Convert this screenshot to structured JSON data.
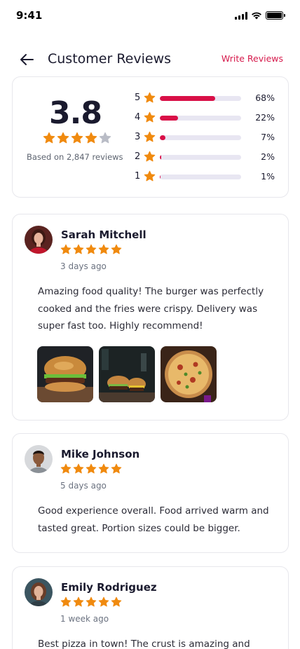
{
  "status": {
    "time": "9:41"
  },
  "header": {
    "title": "Customer Reviews",
    "write_label": "Write Reviews"
  },
  "summary": {
    "average": "3.8",
    "average_stars_filled": 4,
    "based_on": "Based on 2,847 reviews",
    "distribution": [
      {
        "stars": "5",
        "percent": "68%",
        "value": 68
      },
      {
        "stars": "4",
        "percent": "22%",
        "value": 22
      },
      {
        "stars": "3",
        "percent": "7%",
        "value": 7
      },
      {
        "stars": "2",
        "percent": "2%",
        "value": 2
      },
      {
        "stars": "1",
        "percent": "1%",
        "value": 1
      }
    ]
  },
  "reviews": [
    {
      "name": "Sarah Mitchell",
      "rating": 5,
      "date": "3 days ago",
      "text": "Amazing food quality! The burger was perfectly cooked and the fries were crispy. Delivery was super fast too. Highly recommend!",
      "photos": [
        "burger-photo",
        "burgers-photo",
        "pizza-photo"
      ]
    },
    {
      "name": "Mike Johnson",
      "rating": 5,
      "date": "5 days ago",
      "text": "Good experience overall. Food arrived warm and tasted great. Portion sizes could be bigger."
    },
    {
      "name": "Emily Rodriguez",
      "rating": 5,
      "date": "1 week ago",
      "text": "Best pizza in town! The crust is amazing and"
    }
  ],
  "colors": {
    "accent": "#d6194b",
    "bar": "#d90f47",
    "star": "#f08a0f",
    "star_empty": "#b9bcc6"
  }
}
